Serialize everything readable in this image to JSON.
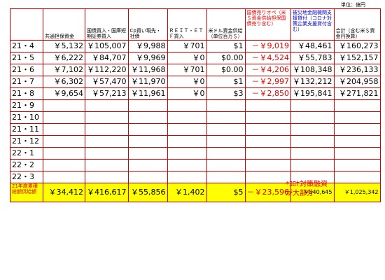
{
  "unit_label": "単位：億円",
  "columns": [
    {
      "label": "",
      "color": "black"
    },
    {
      "label": "共通担保資金",
      "color": "black"
    },
    {
      "label": "国債買入・国庫短期証券買入",
      "color": "black"
    },
    {
      "label": "Cp買い現先・社債",
      "color": "black"
    },
    {
      "label": "ＲＥＩＴ・ＥＴＦ買入",
      "color": "black"
    },
    {
      "label": "米ドル資金供給（単位百万＄）",
      "color": "black"
    },
    {
      "label": "国債売りオペ（米＄資金供給担保国債売り含む）",
      "color": "red"
    },
    {
      "label": "被災地金融機関支援貸付（コロナ対策企業支援貸付含む）",
      "color": "blue"
    },
    {
      "label": "合計（含む米＄資金円換算）",
      "color": "black"
    }
  ],
  "rows": [
    {
      "period": "21・4",
      "c1": "￥5,132",
      "c2": "￥105,007",
      "c3": "￥9,988",
      "c4": "￥701",
      "c5": "$1",
      "c6": "－￥9,019",
      "c7": "￥48,461",
      "c8": "￥160,273"
    },
    {
      "period": "21・5",
      "c1": "￥6,222",
      "c2": "￥84,707",
      "c3": "￥9,969",
      "c4": "￥0",
      "c5": "$0.00",
      "c6": "－￥4,524",
      "c7": "￥55,783",
      "c8": "￥152,157"
    },
    {
      "period": "21・6",
      "c1": "￥7,102",
      "c2": "￥112,220",
      "c3": "￥11,968",
      "c4": "￥701",
      "c5": "$0.00",
      "c6": "－￥4,206",
      "c7": "￥108,348",
      "c8": "￥236,133"
    },
    {
      "period": "21・7",
      "c1": "￥6,302",
      "c2": "￥57,470",
      "c3": "￥11,970",
      "c4": "￥0",
      "c5": "$1",
      "c6": "－￥2,997",
      "c7": "￥132,212",
      "c8": "￥204,958"
    },
    {
      "period": "21・8",
      "c1": "￥9,654",
      "c2": "￥57,213",
      "c3": "￥11,961",
      "c4": "￥0",
      "c5": "$3",
      "c6": "－￥2,850",
      "c7": "￥195,841",
      "c8": "￥271,821"
    },
    {
      "period": "21・9",
      "c1": "",
      "c2": "",
      "c3": "",
      "c4": "",
      "c5": "",
      "c6": "",
      "c7": "",
      "c8": ""
    },
    {
      "period": "21・10",
      "c1": "",
      "c2": "",
      "c3": "",
      "c4": "",
      "c5": "",
      "c6": "",
      "c7": "",
      "c8": ""
    },
    {
      "period": "21・11",
      "c1": "",
      "c2": "",
      "c3": "",
      "c4": "",
      "c5": "",
      "c6": "",
      "c7": "",
      "c8": ""
    },
    {
      "period": "21・12",
      "c1": "",
      "c2": "",
      "c3": "",
      "c4": "",
      "c5": "",
      "c6": "",
      "c7": "",
      "c8": ""
    },
    {
      "period": "22・1",
      "c1": "",
      "c2": "",
      "c3": "",
      "c4": "",
      "c5": "",
      "c6": "",
      "c7": "",
      "c8": ""
    },
    {
      "period": "22・2",
      "c1": "",
      "c2": "",
      "c3": "",
      "c4": "",
      "c5": "",
      "c6": "",
      "c7": "",
      "c8": ""
    },
    {
      "period": "22・3",
      "c1": "",
      "c2": "",
      "c3": "",
      "c4": "",
      "c5": "",
      "c6": "",
      "c7": "",
      "c8": ""
    }
  ],
  "total": {
    "label": "21年度累積総額供給額",
    "c1": "￥34,412",
    "c2": "￥416,617",
    "c3": "￥55,856",
    "c4": "￥1,402",
    "c5": "$5",
    "c6": "－￥23,596",
    "c7": "￥540,645",
    "c8": "￥1,025,342"
  },
  "note": "*ｺﾛﾅ対策融資が大部分"
}
